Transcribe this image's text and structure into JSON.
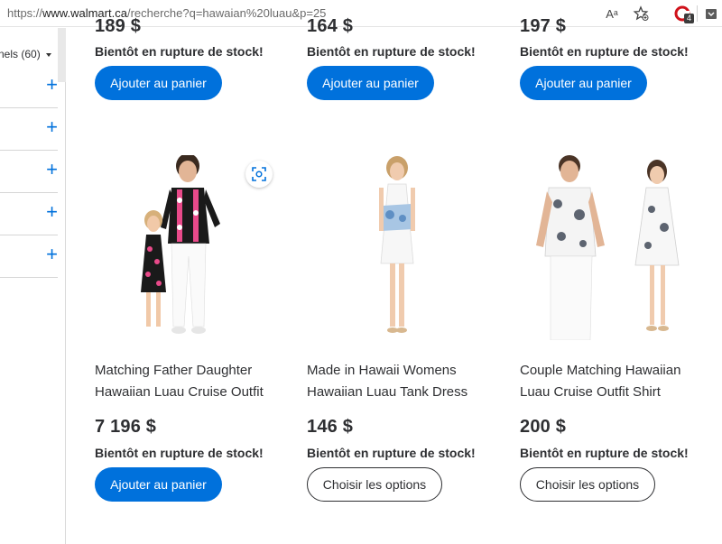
{
  "browser": {
    "url_prefix": "https://",
    "url_host": "www.walmart.ca",
    "url_path": "/recherche?q=hawaian%20luau&p=25",
    "read_aloud_label": "Aᵃ",
    "extension_badge": "4"
  },
  "sidebar": {
    "select_label": "nels (60)",
    "filters": [
      {
        "expand_symbol": "+"
      },
      {
        "expand_symbol": "+"
      },
      {
        "expand_symbol": "+"
      },
      {
        "expand_symbol": "+"
      },
      {
        "expand_symbol": "+"
      }
    ]
  },
  "top_row": [
    {
      "price_partial": "189 $",
      "stock": "Bientôt en rupture de stock!",
      "button": "Ajouter au panier"
    },
    {
      "price_partial": "164 $",
      "stock": "Bientôt en rupture de stock!",
      "button": "Ajouter au panier"
    },
    {
      "price_partial": "197 $",
      "stock": "Bientôt en rupture de stock!",
      "button": "Ajouter au panier"
    }
  ],
  "products": [
    {
      "title_line1": "Matching Father Daughter",
      "title_line2": "Hawaiian Luau Cruise Outfit",
      "price": "7 196 $",
      "stock": "Bientôt en rupture de stock!",
      "button": "Ajouter au panier"
    },
    {
      "title_line1": "Made in Hawaii Womens",
      "title_line2": "Hawaiian Luau Tank Dress",
      "price": "146 $",
      "stock": "Bientôt en rupture de stock!",
      "button": "Choisir les options"
    },
    {
      "title_line1": "Couple Matching Hawaiian",
      "title_line2": "Luau Cruise Outfit Shirt",
      "price": "200 $",
      "stock": "Bientôt en rupture de stock!",
      "button": "Choisir les options"
    }
  ],
  "colors": {
    "accent": "#0071dc",
    "text": "#2e2f32"
  }
}
